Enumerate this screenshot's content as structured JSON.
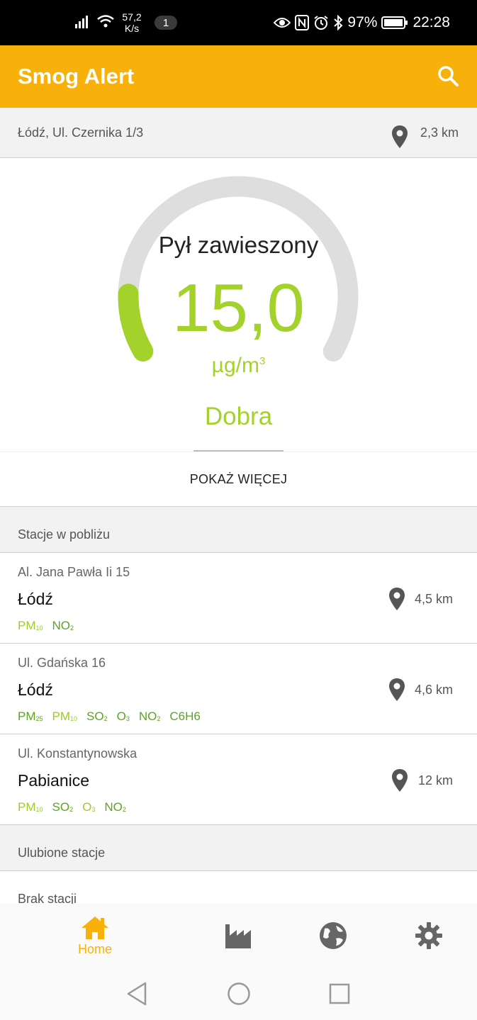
{
  "status_bar": {
    "speed_value": "57,2",
    "speed_unit": "K/s",
    "notification_count": "1",
    "battery": "97%",
    "time": "22:28"
  },
  "app_bar": {
    "title": "Smog Alert"
  },
  "location": {
    "address": "Łódź, Ul. Czernika 1/3",
    "distance": "2,3 km"
  },
  "gauge": {
    "label": "Pył zawieszony",
    "value": "15,0",
    "unit_base": "µg/m",
    "unit_exp": "3",
    "quality": "Dobra",
    "level_fraction": 0.13,
    "track_color": "#dedede",
    "fill_color": "#a3d22a"
  },
  "show_more": "POKAŻ WIĘCEJ",
  "nearby": {
    "header": "Stacje w pobliżu",
    "stations": [
      {
        "street": "Al. Jana Pawła Ii 15",
        "city": "Łódź",
        "distance": "4,5 km",
        "tags": [
          {
            "base": "PM",
            "sub": "10",
            "light": true
          },
          {
            "base": "NO",
            "sub": "2",
            "light": false
          }
        ]
      },
      {
        "street": "Ul. Gdańska 16",
        "city": "Łódź",
        "distance": "4,6 km",
        "tags": [
          {
            "base": "PM",
            "sub": "25",
            "light": false
          },
          {
            "base": "PM",
            "sub": "10",
            "light": true
          },
          {
            "base": "SO",
            "sub": "2",
            "light": false
          },
          {
            "base": "O",
            "sub": "3",
            "light": false
          },
          {
            "base": "NO",
            "sub": "2",
            "light": false
          },
          {
            "base": "C6H6",
            "sub": "",
            "light": false
          }
        ]
      },
      {
        "street": "Ul. Konstantynowska",
        "city": "Pabianice",
        "distance": "12 km",
        "tags": [
          {
            "base": "PM",
            "sub": "10",
            "light": true
          },
          {
            "base": "SO",
            "sub": "2",
            "light": false
          },
          {
            "base": "O",
            "sub": "3",
            "light": true
          },
          {
            "base": "NO",
            "sub": "2",
            "light": false
          }
        ]
      }
    ]
  },
  "favorites": {
    "header": "Ulubione stacje",
    "empty_text": "Brak stacji"
  },
  "bottom_nav": {
    "home_label": "Home",
    "active_color": "#f8b10a",
    "inactive_color": "#666666",
    "icons": [
      "home-icon",
      "factory-icon",
      "globe-icon",
      "gear-icon"
    ]
  },
  "system_nav": {
    "icons": [
      "back-icon",
      "home-circle-icon",
      "recents-icon"
    ]
  }
}
